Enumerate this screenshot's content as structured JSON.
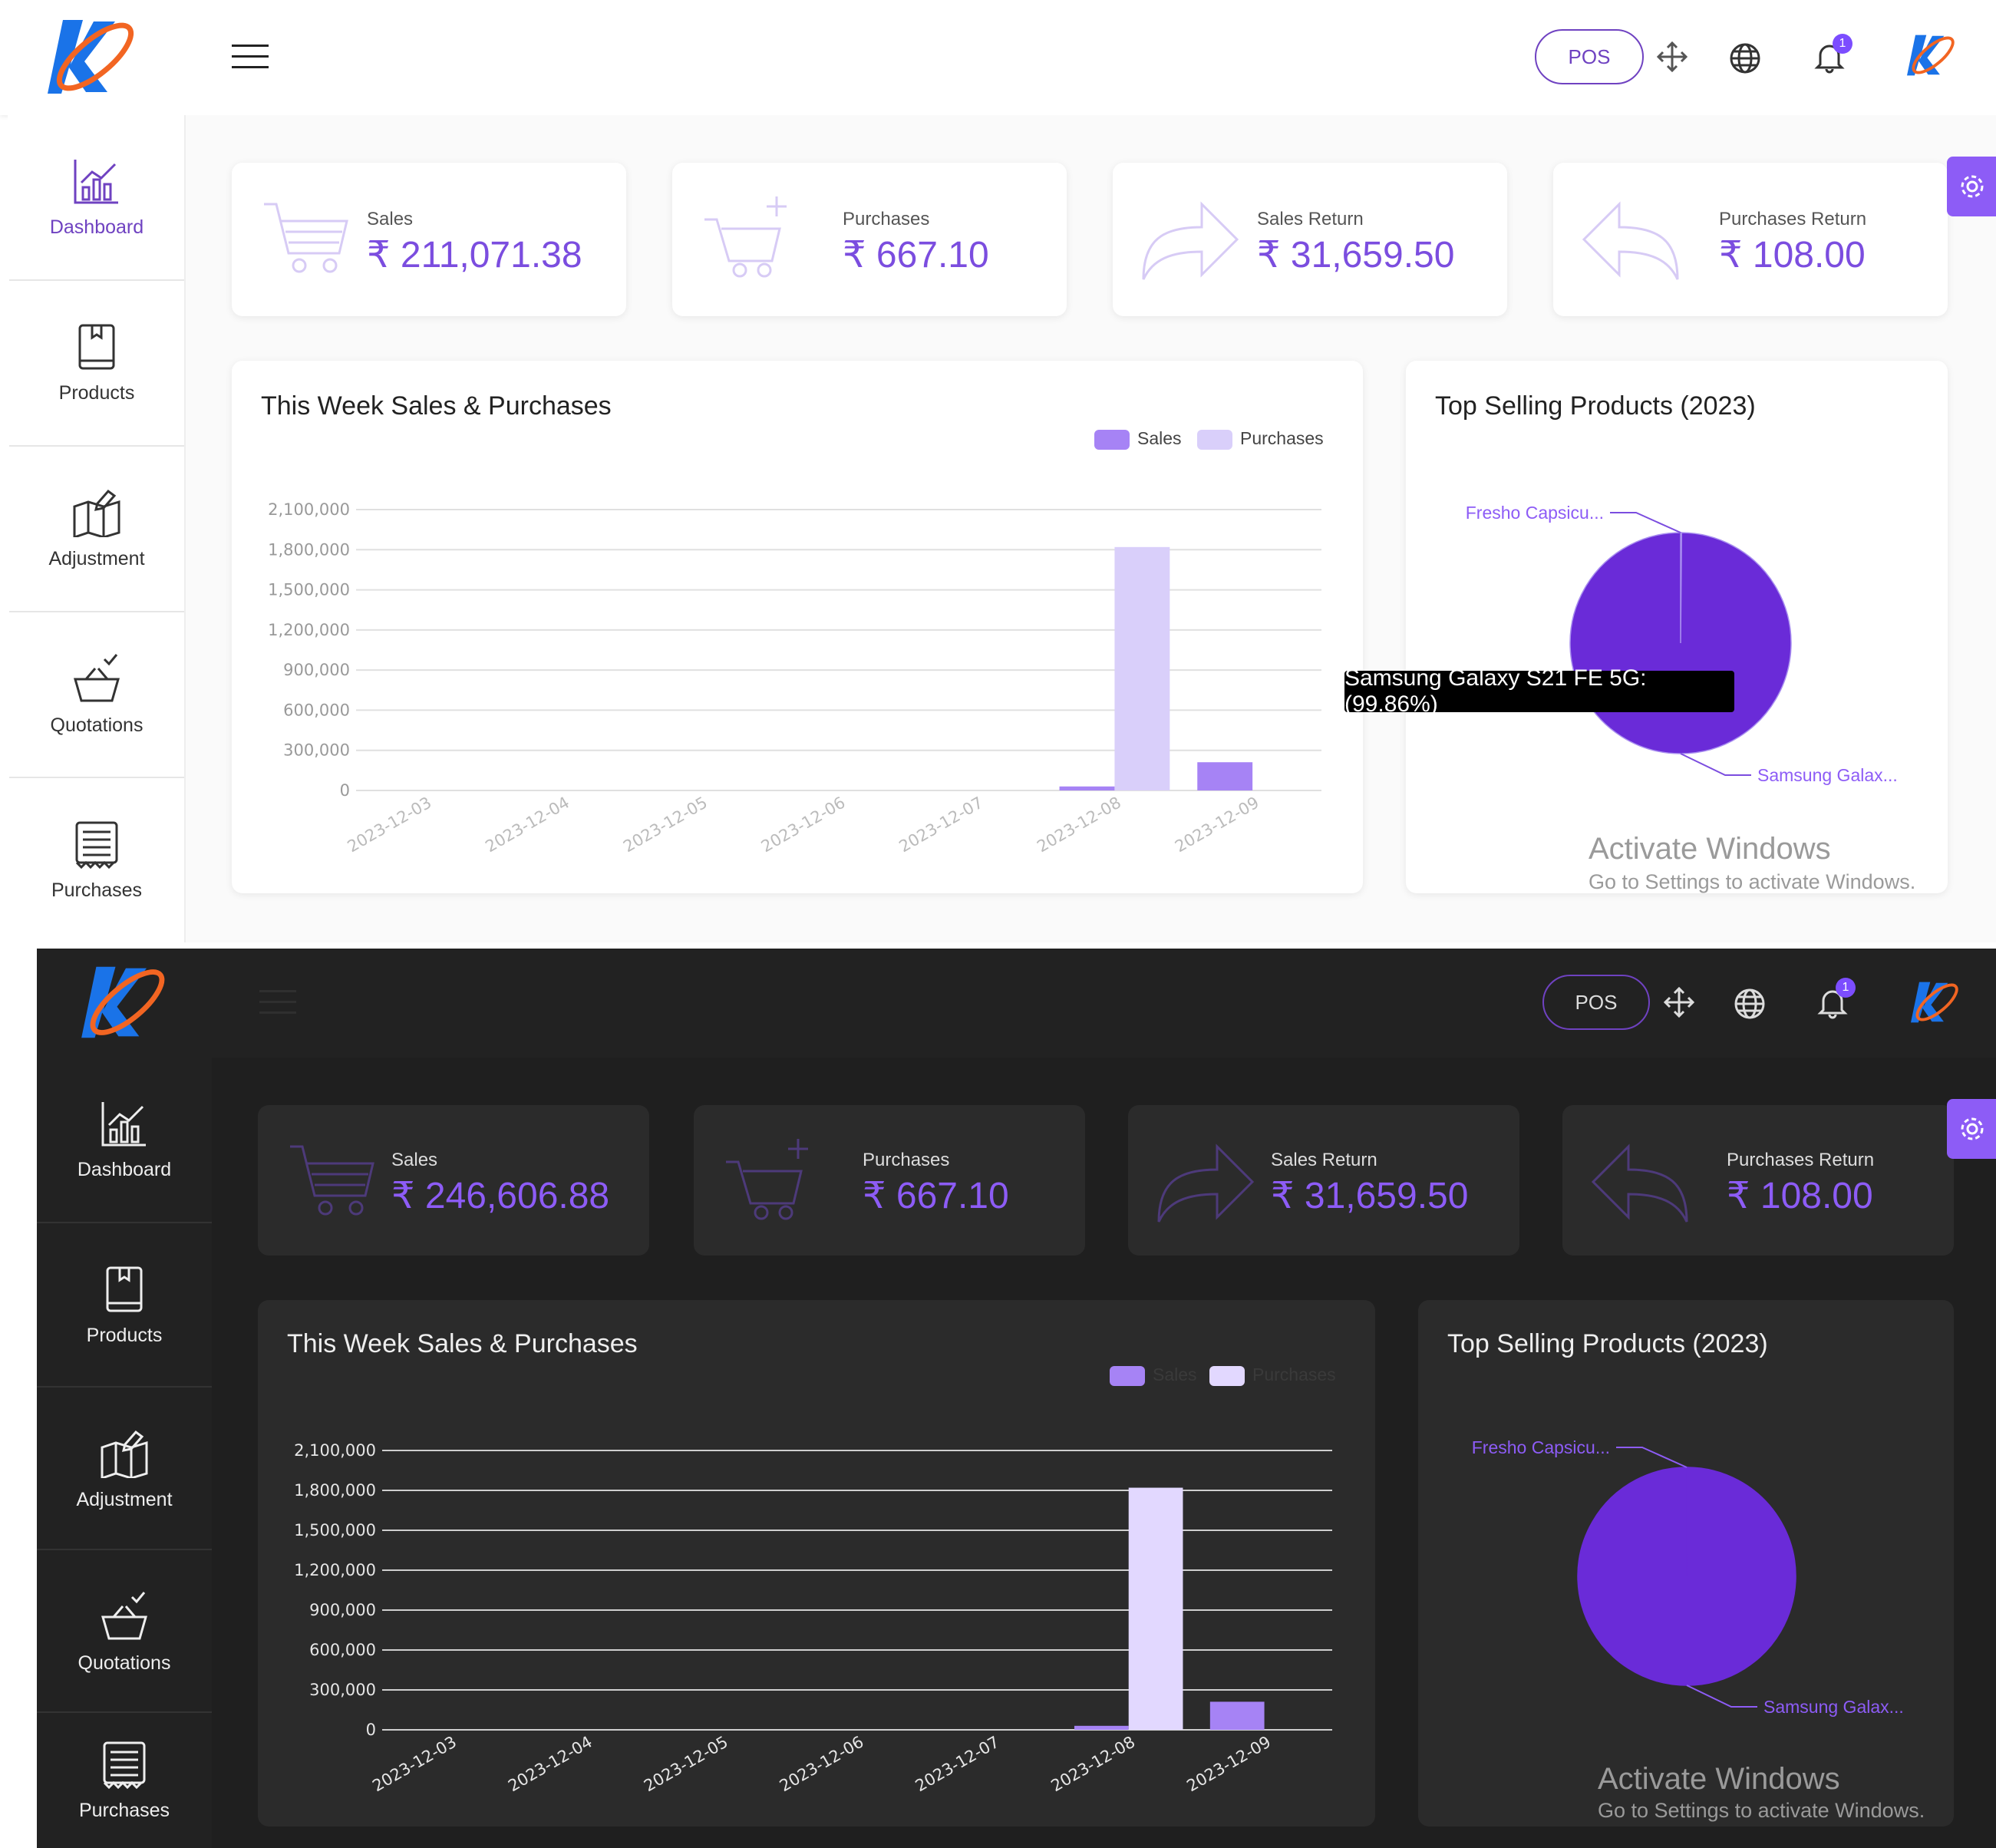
{
  "header": {
    "pos_label": "POS",
    "notification_count": "1"
  },
  "sidebar": {
    "items": [
      {
        "label": "Dashboard",
        "icon": "dashboard-chart-icon"
      },
      {
        "label": "Products",
        "icon": "book-icon"
      },
      {
        "label": "Adjustment",
        "icon": "map-edit-icon"
      },
      {
        "label": "Quotations",
        "icon": "basket-check-icon"
      },
      {
        "label": "Purchases",
        "icon": "receipt-icon"
      }
    ]
  },
  "light": {
    "cards": [
      {
        "label": "Sales",
        "value": "₹ 211,071.38",
        "icon": "cart-icon"
      },
      {
        "label": "Purchases",
        "value": "₹ 667.10",
        "icon": "cart-plus-icon"
      },
      {
        "label": "Sales Return",
        "value": "₹ 31,659.50",
        "icon": "forward-arrow-icon"
      },
      {
        "label": "Purchases Return",
        "value": "₹ 108.00",
        "icon": "reply-arrow-icon"
      }
    ],
    "tooltip": "Samsung Galaxy S21 FE 5G: (99.86%)"
  },
  "dark": {
    "cards": [
      {
        "label": "Sales",
        "value": "₹ 246,606.88",
        "icon": "cart-icon"
      },
      {
        "label": "Purchases",
        "value": "₹ 667.10",
        "icon": "cart-plus-icon"
      },
      {
        "label": "Sales Return",
        "value": "₹ 31,659.50",
        "icon": "forward-arrow-icon"
      },
      {
        "label": "Purchases Return",
        "value": "₹ 108.00",
        "icon": "reply-arrow-icon"
      }
    ]
  },
  "watermark": {
    "line1": "Activate Windows",
    "line2": "Go to Settings to activate Windows."
  },
  "colors": {
    "accent": "#7b4ddf",
    "sales": "#a683f5",
    "purchases": "#d9cffa",
    "pie": "#6a2bd8"
  },
  "chart_data": [
    {
      "type": "bar",
      "title": "This Week Sales & Purchases",
      "categories": [
        "2023-12-03",
        "2023-12-04",
        "2023-12-05",
        "2023-12-06",
        "2023-12-07",
        "2023-12-08",
        "2023-12-09"
      ],
      "series": [
        {
          "name": "Sales",
          "values": [
            0,
            0,
            0,
            0,
            0,
            30000,
            211071.38
          ]
        },
        {
          "name": "Purchases",
          "values": [
            0,
            0,
            0,
            0,
            0,
            1820000,
            0
          ]
        }
      ],
      "ylim": [
        0,
        2100000
      ],
      "yticks": [
        "0",
        "300,000",
        "600,000",
        "900,000",
        "1,200,000",
        "1,500,000",
        "1,800,000",
        "2,100,000"
      ],
      "legend": "top-right",
      "grid": true
    },
    {
      "type": "pie",
      "title": "Top Selling Products (2023)",
      "labels": [
        "Fresho Capsicu...",
        "Samsung Galax..."
      ],
      "values": [
        0.14,
        99.86
      ]
    }
  ]
}
